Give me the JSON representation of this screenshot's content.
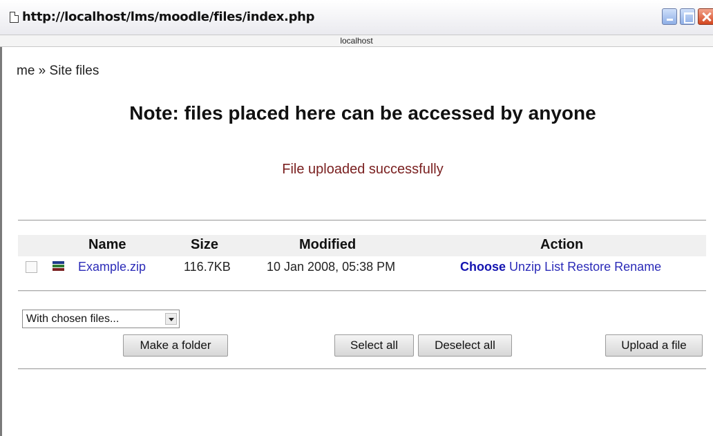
{
  "window": {
    "url": "http://localhost/lms/moodle/files/index.php",
    "host": "localhost"
  },
  "breadcrumb": "me » Site files",
  "note": "Note: files placed here can be accessed by anyone",
  "status_message": "File uploaded successfully",
  "table": {
    "headers": {
      "name": "Name",
      "size": "Size",
      "modified": "Modified",
      "action": "Action"
    },
    "rows": [
      {
        "name": "Example.zip",
        "size": "116.7KB",
        "modified": "10 Jan 2008, 05:38 PM",
        "actions": {
          "choose": "Choose",
          "unzip": "Unzip",
          "list": "List",
          "restore": "Restore",
          "rename": "Rename"
        }
      }
    ]
  },
  "bulk_action": {
    "selected": "With chosen files..."
  },
  "buttons": {
    "make_folder": "Make a folder",
    "select_all": "Select all",
    "deselect_all": "Deselect all",
    "upload": "Upload a file"
  },
  "colors": {
    "link": "#2b2bb8",
    "status": "#7a2020",
    "header_bg": "#f0f0f0"
  }
}
